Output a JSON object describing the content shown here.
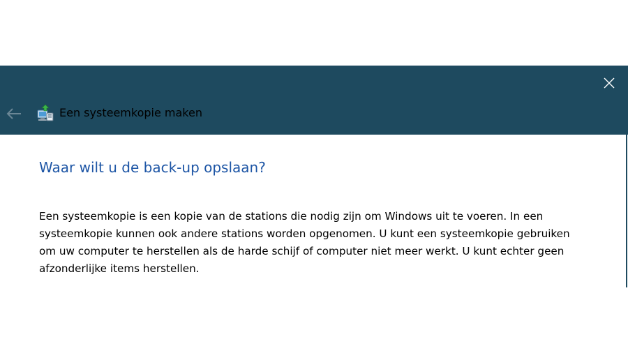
{
  "window": {
    "title": "Een systeemkopie maken",
    "icons": {
      "back": "back-arrow-icon",
      "app": "backup-computer-icon",
      "close": "close-icon"
    }
  },
  "content": {
    "heading": "Waar wilt u de back-up opslaan?",
    "description": "Een systeemkopie is een kopie van de stations die nodig zijn om Windows uit te voeren. In een systeemkopie kunnen ook andere stations worden opgenomen. U kunt een systeemkopie gebruiken om uw computer te herstellen als de harde schijf of computer niet meer werkt. U kunt echter geen afzonderlijke items herstellen."
  },
  "colors": {
    "titlebar": "#1e4a5f",
    "heading": "#1d55a5",
    "text": "#000000",
    "background": "#ffffff"
  }
}
